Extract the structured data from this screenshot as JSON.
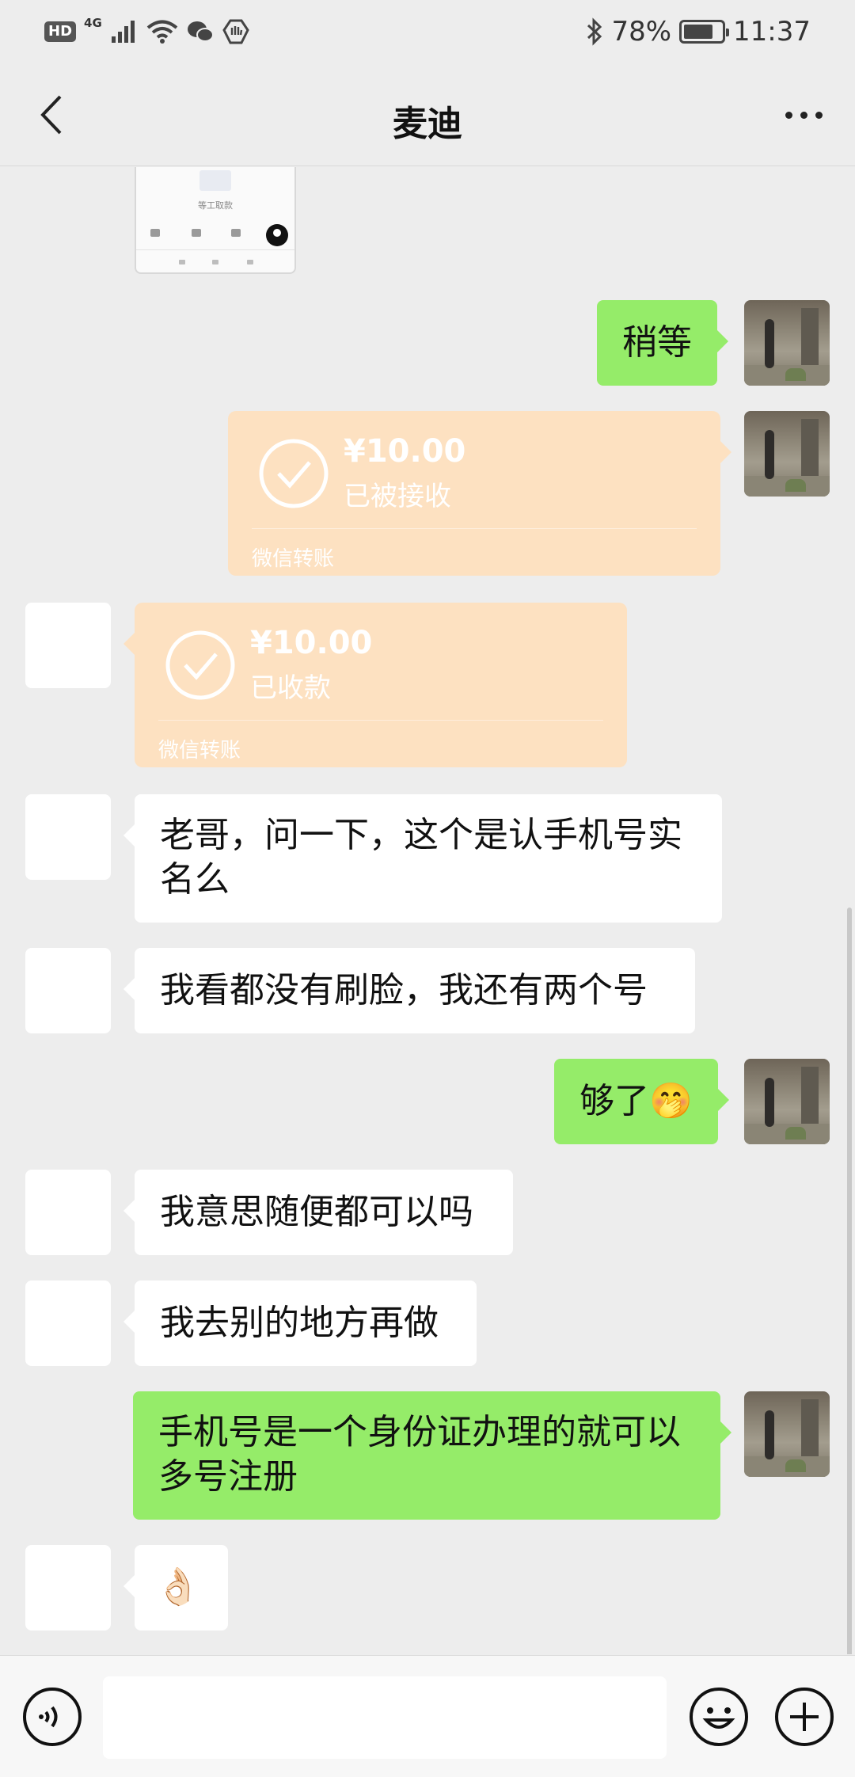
{
  "status_bar": {
    "hd": "HD",
    "network": "4G",
    "battery_percent": "78%",
    "battery_level": 0.78,
    "time": "11:37",
    "left_icons": [
      "signal-icon",
      "wifi-icon",
      "wechat-icon",
      "shield-icon"
    ],
    "right_icons": [
      "bluetooth-icon",
      "battery-icon"
    ]
  },
  "header": {
    "title": "麦迪",
    "back_icon": "chevron-left-icon",
    "more_icon": "more-dots-icon"
  },
  "partial_image": {
    "caption": "等工取款"
  },
  "messages": [
    {
      "side": "out",
      "text": "稍等"
    },
    {
      "side": "out",
      "type": "transfer",
      "amount": "¥10.00",
      "status": "已被接收",
      "footer": "微信转账"
    },
    {
      "side": "in",
      "type": "transfer",
      "amount": "¥10.00",
      "status": "已收款",
      "footer": "微信转账"
    },
    {
      "side": "in",
      "text_line1": "老哥，问一下，这个是认手机号实",
      "text_line2": "名么"
    },
    {
      "side": "in",
      "text": "我看都没有刷脸，我还有两个号"
    },
    {
      "side": "out",
      "text": "够了",
      "emoji": "🤭"
    },
    {
      "side": "in",
      "text": "我意思随便都可以吗"
    },
    {
      "side": "in",
      "text": "我去别的地方再做"
    },
    {
      "side": "out",
      "text_line1": "手机号是一个身份证办理的就可以",
      "text_line2": "多号注册"
    },
    {
      "side": "in",
      "emoji": "👌🏻"
    }
  ],
  "input_bar": {
    "voice_icon": "voice-icon",
    "emoji_icon": "emoji-icon",
    "plus_icon": "plus-circle-icon",
    "value": ""
  },
  "colors": {
    "background": "#ededed",
    "outgoing_bubble": "#95ec69",
    "incoming_bubble": "#ffffff",
    "transfer_card": "#fde1c1"
  }
}
